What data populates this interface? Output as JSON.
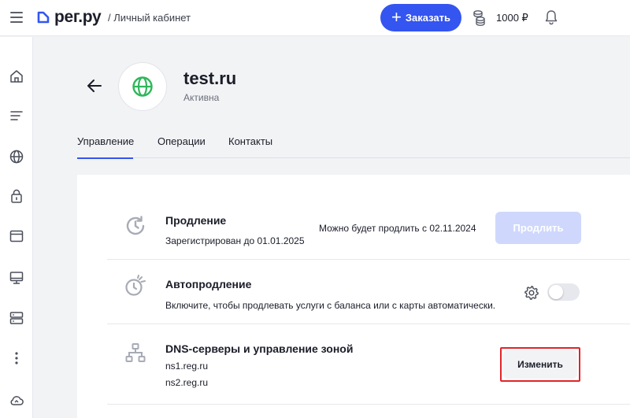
{
  "header": {
    "logo_text": "рег.ру",
    "breadcrumb": "/ Личный кабинет",
    "order_label": "Заказать",
    "balance": "1000 ₽",
    "icons": [
      "menu-icon",
      "coins-icon",
      "bell-icon"
    ]
  },
  "sidebar": {
    "items": [
      {
        "icon": "home-icon"
      },
      {
        "icon": "list-icon"
      },
      {
        "icon": "globe-icon"
      },
      {
        "icon": "lock-icon"
      },
      {
        "icon": "browser-window-icon"
      },
      {
        "icon": "monitor-icon"
      },
      {
        "icon": "server-icon"
      },
      {
        "icon": "more-dots-icon"
      },
      {
        "icon": "cloud-icon"
      }
    ]
  },
  "domain": {
    "name": "test.ru",
    "status": "Активна",
    "icon_color": "#2fb75a"
  },
  "tabs": [
    {
      "label": "Управление",
      "active": true
    },
    {
      "label": "Операции",
      "active": false
    },
    {
      "label": "Контакты",
      "active": false
    }
  ],
  "renewal": {
    "title": "Продление",
    "subtitle": "Зарегистрирован до 01.01.2025",
    "note": "Можно будет продлить с 02.11.2024",
    "button": "Продлить"
  },
  "autorenew": {
    "title": "Автопродление",
    "subtitle": "Включите, чтобы продлевать услуги с баланса или с карты автоматически.",
    "enabled": false
  },
  "dns": {
    "title": "DNS-серверы и управление зоной",
    "servers": [
      "ns1.reg.ru",
      "ns2.reg.ru"
    ],
    "button": "Изменить"
  },
  "colors": {
    "accent": "#3455f0",
    "highlight": "#e0242a",
    "disabled_button": "#cfd8fc"
  }
}
